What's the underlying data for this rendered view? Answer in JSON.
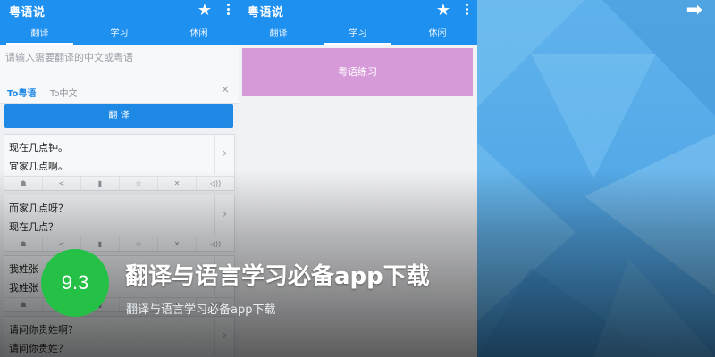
{
  "left_phone": {
    "app_title": "粤语说",
    "star_icon": "★",
    "tabs": [
      {
        "label": "翻译",
        "active": true
      },
      {
        "label": "学习",
        "active": false
      },
      {
        "label": "休闲",
        "active": false
      }
    ],
    "input_placeholder": "请输入需要翻译的中文或粤语",
    "lang_to_yue": "To粤语",
    "lang_to_zh": "To中文",
    "clear_icon": "×",
    "translate_button": "翻 译",
    "cards": [
      {
        "line1": "现在几点钟。",
        "line2": "宜家几点啊。"
      },
      {
        "line1": "而家几点呀？",
        "line2": "现在几点？"
      },
      {
        "line1": "我姓张",
        "line2": "我姓张"
      },
      {
        "line1": "请问你贵姓啊？",
        "line2": "请问你贵姓？"
      }
    ],
    "card_action_icons": [
      "☗",
      "<",
      "▮",
      "☆",
      "✕",
      "◁))"
    ],
    "chevron": "›"
  },
  "mid_phone": {
    "app_title": "粤语说",
    "star_icon": "★",
    "tabs": [
      {
        "label": "翻译",
        "active": false
      },
      {
        "label": "学习",
        "active": true
      },
      {
        "label": "休闲",
        "active": false
      }
    ],
    "practice_button": "粤语练习"
  },
  "share_icon": "➡",
  "overlay": {
    "rating": "9.3",
    "title": "翻译与语言学习必备app下载",
    "subtitle": "翻译与语言学习必备app下载"
  },
  "colors": {
    "app_blue": "#1e90f0",
    "practice_purple": "#d79ad9",
    "rating_green": "#25c147",
    "panel_blue": "#5fb2ec"
  }
}
